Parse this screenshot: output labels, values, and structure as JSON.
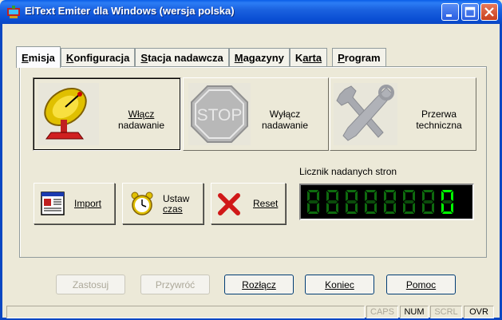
{
  "window": {
    "title": "ElText Emiter dla Windows (wersja polska)"
  },
  "tabs": [
    {
      "label_first": "E",
      "label_rest": "misja"
    },
    {
      "label_first": "K",
      "label_rest": "onfiguracja"
    },
    {
      "label_first": "S",
      "label_rest": "tacja nadawcza"
    },
    {
      "label_first": "M",
      "label_rest": "agazyny"
    },
    {
      "label_first": "K",
      "label_rest": "arta"
    },
    {
      "label_first": "P",
      "label_rest": "rogram"
    }
  ],
  "big_buttons": {
    "start": {
      "line1": "Włącz",
      "line2": "nadawanie",
      "icon": "satellite-dish-icon"
    },
    "stop": {
      "line1": "Wyłącz",
      "line2": "nadawanie",
      "icon": "stop-sign-icon",
      "icon_text": "STOP"
    },
    "pause": {
      "line1": "Przerwa",
      "line2": "techniczna",
      "icon": "tools-icon"
    }
  },
  "small_buttons": {
    "import": {
      "label": "Import",
      "icon": "document-icon"
    },
    "set_time": {
      "line1": "Ustaw",
      "line2": "czas",
      "icon": "alarm-clock-icon"
    },
    "reset": {
      "label": "Reset",
      "icon": "red-x-icon"
    }
  },
  "counter": {
    "label": "Licznik nadanych stron",
    "value": "00000000",
    "color_active": "#00ff00",
    "color_inactive": "#0a4a0a"
  },
  "bottom_buttons": {
    "apply": "Zastosuj",
    "restore": "Przywróć",
    "disconnect": "Rozłącz",
    "end": "Koniec",
    "help": "Pomoc"
  },
  "status": {
    "caps": "CAPS",
    "num": "NUM",
    "scrl": "SCRL",
    "ovr": "OVR"
  }
}
